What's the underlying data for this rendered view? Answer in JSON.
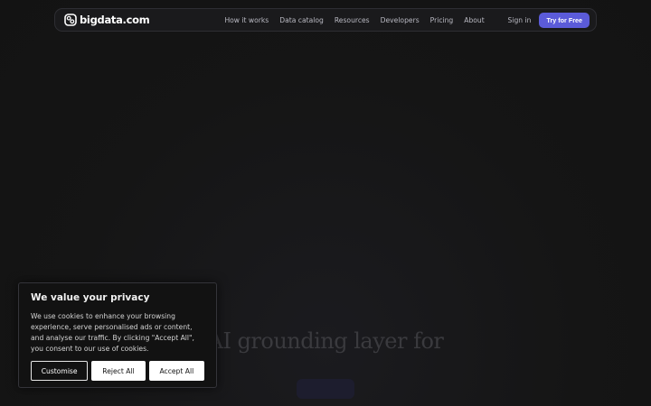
{
  "brand": {
    "name": "bigdata.com"
  },
  "nav": {
    "links": [
      "How it works",
      "Data catalog",
      "Resources",
      "Developers",
      "Pricing",
      "About"
    ],
    "sign_in": "Sign in",
    "cta": "Try for Free"
  },
  "hero": {
    "title": "AI grounding layer for",
    "subtitle": "",
    "button": ""
  },
  "cookie_banner": {
    "title": "We value your privacy",
    "text": "We use cookies to enhance your browsing experience, serve personalised ads or content, and analyse our traffic. By clicking \"Accept All\", you consent to our use of cookies.",
    "customise": "Customise",
    "reject": "Reject All",
    "accept": "Accept All"
  },
  "colors": {
    "background": "#141414",
    "accent": "#5b5bd9"
  }
}
